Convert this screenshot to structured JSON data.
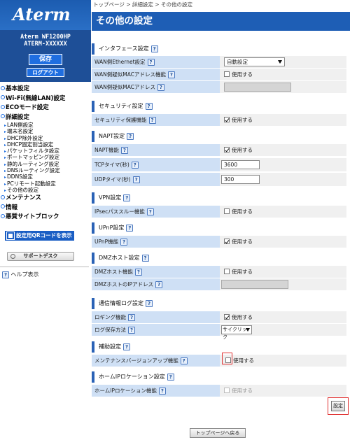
{
  "sidebar": {
    "logo": "Aterm",
    "model": "Aterm WF1200HP",
    "device_name": "ATERM-XXXXXX",
    "save_label": "保存",
    "logout_label": "ログアウト",
    "menu": {
      "basic": "基本設定",
      "wifi": "Wi-Fi(無線LAN)設定",
      "eco": "ECOモード設定",
      "detail": "詳細設定",
      "detail_items": [
        "LAN側設定",
        "端末名設定",
        "DHCP除外設定",
        "DHCP固定割当設定",
        "パケットフィルタ設定",
        "ポートマッピング設定",
        "静的ルーティング設定",
        "DNSルーティング設定",
        "DDNS設定",
        "PCリモート起動設定",
        "その他の設定"
      ],
      "maintenance": "メンテナンス",
      "info": "情報",
      "blocking": "悪質サイトブロック"
    },
    "qr_label": "設定用QRコードを表示",
    "support_label": "サポートデスク",
    "help_label": "ヘルプ表示"
  },
  "main": {
    "breadcrumb": "トップページ > 詳細設定 > その他の設定",
    "title": "その他の設定",
    "help_mark": "?",
    "sections": {
      "interface": {
        "title": "インタフェース設定",
        "wan_ethernet_label": "WAN側Ethernet設定",
        "wan_ethernet_value": "自動設定",
        "wan_mac_clone_label": "WAN側疑似MACアドレス機能",
        "wan_mac_clone_value": "使用する",
        "wan_mac_addr_label": "WAN側疑似MACアドレス"
      },
      "security": {
        "title": "セキュリティ設定",
        "protect_label": "セキュリティ保護機能",
        "protect_value": "使用する"
      },
      "napt": {
        "title": "NAPT設定",
        "napt_label": "NAPT機能",
        "napt_value": "使用する",
        "tcp_label": "TCPタイマ(秒)",
        "tcp_value": "3600",
        "udp_label": "UDPタイマ(秒)",
        "udp_value": "300"
      },
      "vpn": {
        "title": "VPN設定",
        "ipsec_label": "IPsecパススルー機能",
        "ipsec_value": "使用する"
      },
      "upnp": {
        "title": "UPnP設定",
        "upnp_label": "UPnP機能",
        "upnp_value": "使用する"
      },
      "dmz": {
        "title": "DMZホスト設定",
        "dmz_label": "DMZホスト機能",
        "dmz_value": "使用する",
        "dmz_ip_label": "DMZホストのIPアドレス"
      },
      "log": {
        "title": "通信情報ログ設定",
        "logging_label": "ロギング機能",
        "logging_value": "使用する",
        "save_method_label": "ログ保存方法",
        "save_method_value": "サイクリック"
      },
      "aux": {
        "title": "補助設定",
        "update_label": "メンテナンスバージョンアップ機能",
        "update_value": "使用する"
      },
      "homeip": {
        "title": "ホームIPロケーション設定",
        "homeip_label": "ホームIPロケーション機能",
        "homeip_value": "使用する"
      }
    },
    "set_label": "設定",
    "back_label": "トップページへ戻る"
  }
}
